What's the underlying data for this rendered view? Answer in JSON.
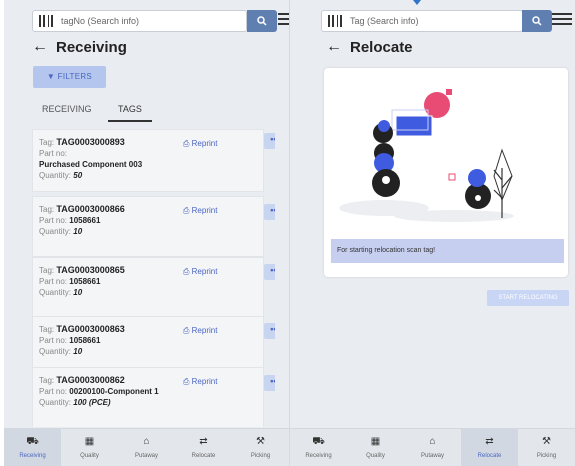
{
  "left": {
    "search_placeholder": "tagNo (Search info)",
    "title": "Receiving",
    "filters_label": "FILTERS",
    "tabs": [
      {
        "label": "RECEIVING",
        "active": false
      },
      {
        "label": "TAGS",
        "active": true
      }
    ],
    "cards": [
      {
        "tag_label": "Tag:",
        "tag": "TAG0003000893",
        "part_label": "Part no:",
        "part": "Purchased Component 003",
        "qty_label": "Quantity:",
        "qty": "50",
        "reprint": "Reprint"
      },
      {
        "tag_label": "Tag:",
        "tag": "TAG0003000866",
        "part_label": "Part no:",
        "part": "1058661",
        "qty_label": "Quantity:",
        "qty": "10",
        "reprint": "Reprint"
      },
      {
        "tag_label": "Tag:",
        "tag": "TAG0003000865",
        "part_label": "Part no:",
        "part": "1058661",
        "qty_label": "Quantity:",
        "qty": "10",
        "reprint": "Reprint"
      },
      {
        "tag_label": "Tag:",
        "tag": "TAG0003000863",
        "part_label": "Part no:",
        "part": "1058661",
        "qty_label": "Quantity:",
        "qty": "10",
        "reprint": "Reprint"
      },
      {
        "tag_label": "Tag:",
        "tag": "TAG0003000862",
        "part_label": "Part no:",
        "part": "00200100-Component 1",
        "qty_label": "Quantity:",
        "qty": "100 (PCE)",
        "reprint": "Reprint"
      }
    ],
    "more_label": "•••",
    "nav": [
      {
        "label": "Receiving",
        "icon": "receiving-icon",
        "active": true
      },
      {
        "label": "Quality",
        "icon": "quality-icon",
        "active": false
      },
      {
        "label": "Putaway",
        "icon": "putaway-icon",
        "active": false
      },
      {
        "label": "Relocate",
        "icon": "relocate-icon",
        "active": false
      },
      {
        "label": "Picking",
        "icon": "picking-icon",
        "active": false
      }
    ]
  },
  "right": {
    "search_placeholder": "Tag (Search info)",
    "title": "Relocate",
    "info_text": "For starting relocation scan tag!",
    "start_button": "START RELOCATING",
    "nav": [
      {
        "label": "Receiving",
        "icon": "receiving-icon",
        "active": false
      },
      {
        "label": "Quality",
        "icon": "quality-icon",
        "active": false
      },
      {
        "label": "Putaway",
        "icon": "putaway-icon",
        "active": false
      },
      {
        "label": "Relocate",
        "icon": "relocate-icon",
        "active": true
      },
      {
        "label": "Picking",
        "icon": "picking-icon",
        "active": false
      }
    ]
  },
  "colors": {
    "accent": "#4a67c2",
    "search_button": "#5f7fb1",
    "filters_bg": "#b4c6ee",
    "info_bg": "#c7cff0",
    "illustration_blue": "#3f5be0",
    "illustration_pink": "#e84b73"
  }
}
